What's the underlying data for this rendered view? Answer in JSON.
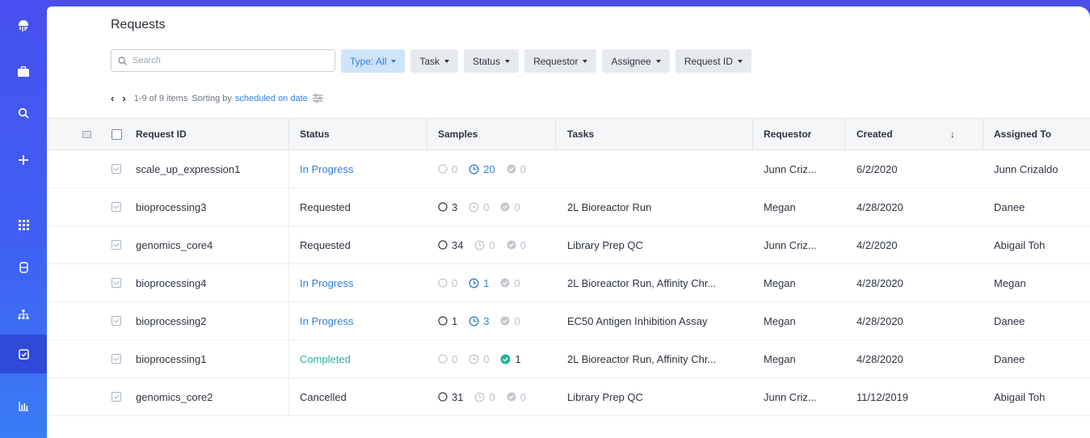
{
  "sidebar": {
    "items": [
      {
        "icon": "logo-icon",
        "active": false
      },
      {
        "icon": "briefcase-icon",
        "active": false
      },
      {
        "icon": "search-icon",
        "active": false
      },
      {
        "icon": "plus-icon",
        "active": false
      },
      {
        "icon": "apps-grid-icon",
        "active": false
      },
      {
        "icon": "database-icon",
        "active": false
      },
      {
        "icon": "hierarchy-icon",
        "active": false
      },
      {
        "icon": "requests-icon",
        "active": true
      },
      {
        "icon": "bar-chart-icon",
        "active": false
      }
    ]
  },
  "header": {
    "title": "Requests"
  },
  "search": {
    "placeholder": "Search"
  },
  "filters": [
    {
      "label": "Type: All",
      "primary": true
    },
    {
      "label": "Task",
      "primary": false
    },
    {
      "label": "Status",
      "primary": false
    },
    {
      "label": "Requestor",
      "primary": false
    },
    {
      "label": "Assignee",
      "primary": false
    },
    {
      "label": "Request ID",
      "primary": false
    }
  ],
  "pager": {
    "range": "1-9 of 9 items",
    "sort_prefix": "Sorting by",
    "sort_value": "scheduled on date"
  },
  "table": {
    "columns": [
      "Request ID",
      "Status",
      "Samples",
      "Tasks",
      "Requestor",
      "Created",
      "Assigned To"
    ],
    "rows": [
      {
        "id": "scale_up_expression1",
        "status": "In Progress",
        "status_kind": "inprogress",
        "samples": [
          0,
          20,
          0
        ],
        "samples_state": [
          "muted",
          "blue",
          "muted"
        ],
        "tasks": "",
        "requestor": "Junn Criz...",
        "created": "6/2/2020",
        "assigned": "Junn Crizaldo"
      },
      {
        "id": "bioprocessing3",
        "status": "Requested",
        "status_kind": "other",
        "samples": [
          3,
          0,
          0
        ],
        "samples_state": [
          "active",
          "muted",
          "muted"
        ],
        "tasks": "2L Bioreactor Run",
        "requestor": "Megan",
        "created": "4/28/2020",
        "assigned": "Danee"
      },
      {
        "id": "genomics_core4",
        "status": "Requested",
        "status_kind": "other",
        "samples": [
          34,
          0,
          0
        ],
        "samples_state": [
          "active",
          "muted",
          "muted"
        ],
        "tasks": "Library Prep QC",
        "requestor": "Junn Criz...",
        "created": "4/2/2020",
        "assigned": "Abigail Toh"
      },
      {
        "id": "bioprocessing4",
        "status": "In Progress",
        "status_kind": "inprogress",
        "samples": [
          0,
          1,
          0
        ],
        "samples_state": [
          "muted",
          "blue",
          "muted"
        ],
        "tasks": "2L Bioreactor Run, Affinity Chr...",
        "requestor": "Megan",
        "created": "4/28/2020",
        "assigned": "Megan"
      },
      {
        "id": "bioprocessing2",
        "status": "In Progress",
        "status_kind": "inprogress",
        "samples": [
          1,
          3,
          0
        ],
        "samples_state": [
          "active",
          "blue",
          "muted"
        ],
        "tasks": "EC50 Antigen Inhibition Assay",
        "requestor": "Megan",
        "created": "4/28/2020",
        "assigned": "Danee"
      },
      {
        "id": "bioprocessing1",
        "status": "Completed",
        "status_kind": "completed",
        "samples": [
          0,
          0,
          1
        ],
        "samples_state": [
          "muted",
          "muted",
          "green"
        ],
        "tasks": "2L Bioreactor Run, Affinity Chr...",
        "requestor": "Megan",
        "created": "4/28/2020",
        "assigned": "Danee"
      },
      {
        "id": "genomics_core2",
        "status": "Cancelled",
        "status_kind": "other",
        "samples": [
          31,
          0,
          0
        ],
        "samples_state": [
          "active",
          "muted",
          "muted"
        ],
        "tasks": "Library Prep QC",
        "requestor": "Junn Criz...",
        "created": "11/12/2019",
        "assigned": "Abigail Toh"
      }
    ]
  },
  "colors": {
    "accent": "#2f7fe0",
    "completed": "#23b49a",
    "sidebar": "#4750f0"
  }
}
